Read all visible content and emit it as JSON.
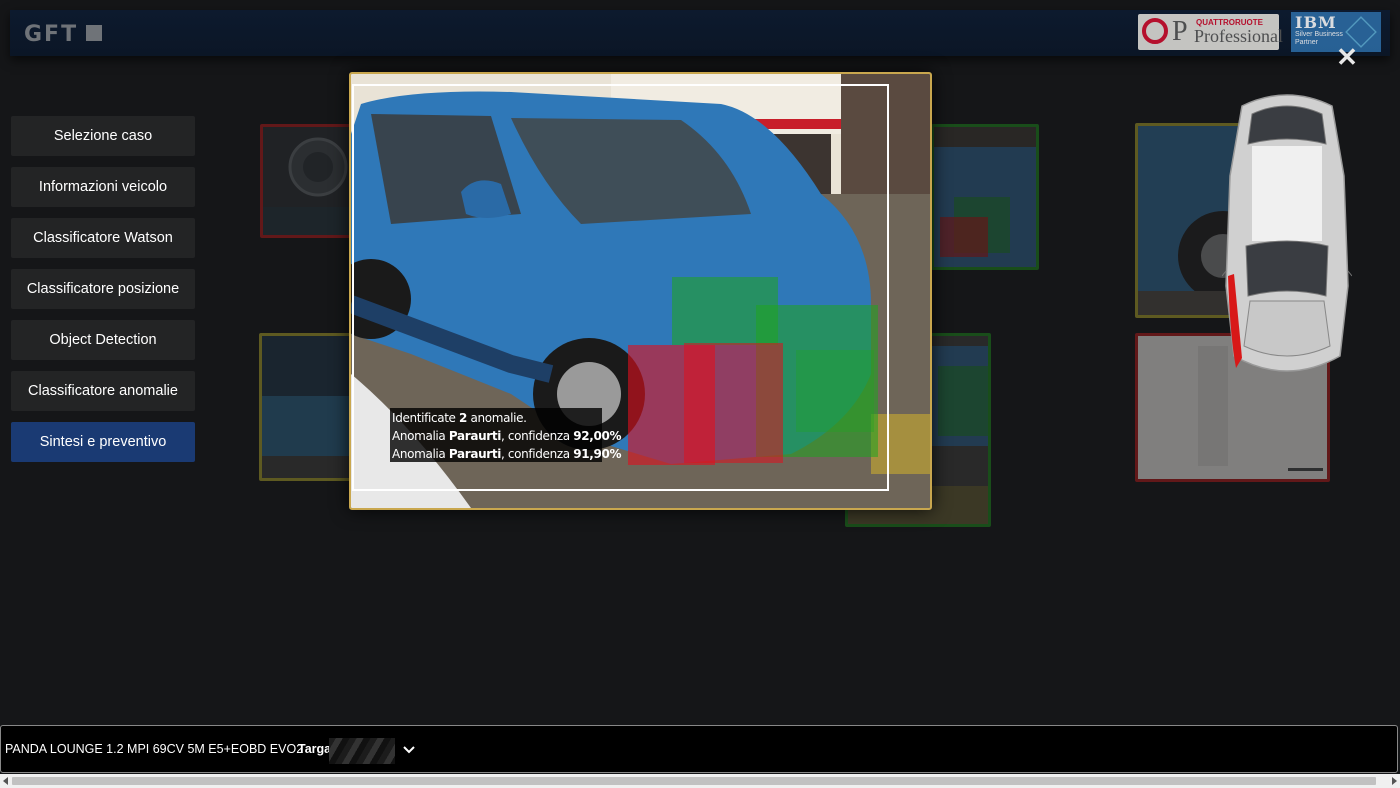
{
  "header": {
    "logo_text": "GFT",
    "partner_logo_1": {
      "small_text": "QUATTRORUOTE",
      "big_text": "Professional"
    },
    "partner_logo_2": {
      "brand": "IBM",
      "sub": "Silver Business Partner"
    }
  },
  "sidebar": {
    "items": [
      {
        "label": "Selezione caso"
      },
      {
        "label": "Informazioni veicolo"
      },
      {
        "label": "Classificatore Watson"
      },
      {
        "label": "Classificatore posizione"
      },
      {
        "label": "Object Detection"
      },
      {
        "label": "Classificatore anomalie"
      },
      {
        "label": "Sintesi e preventivo",
        "active": true
      }
    ]
  },
  "modal": {
    "summary_prefix": "Identificate ",
    "summary_count": "2",
    "summary_suffix": " anomalie.",
    "anomalies": [
      {
        "prefix": "Anomalia ",
        "part": "Paraurti",
        "mid": ", confidenza ",
        "confidence": "92,00%"
      },
      {
        "prefix": "Anomalia ",
        "part": "Paraurti",
        "mid": ", confidenza ",
        "confidence": "91,90%"
      }
    ]
  },
  "bottom_bar": {
    "vehicle_name": "PANDA LOUNGE 1.2 MPI 69CV 5M E5+EOBD EVO2",
    "targa_label": "Targa"
  },
  "colors": {
    "active_nav": "#1a3a73",
    "modal_border": "#c9a74e",
    "damage_red": "#e0101e",
    "detection_green": "#1fa51f"
  }
}
